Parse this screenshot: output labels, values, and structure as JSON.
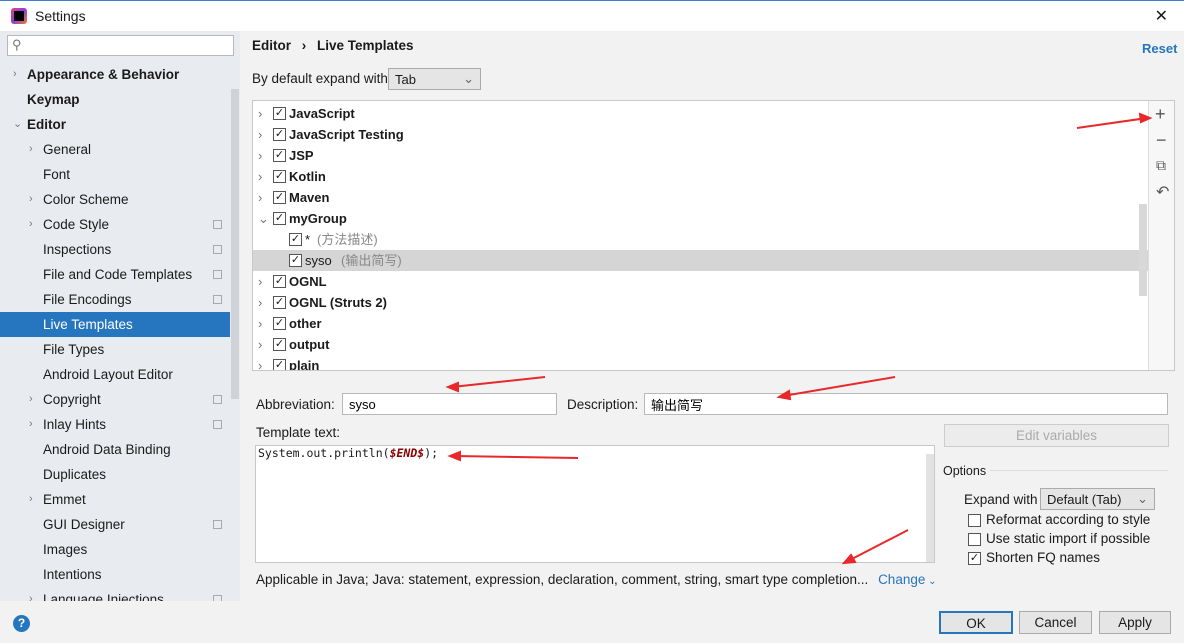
{
  "window": {
    "title": "Settings",
    "close": "✕"
  },
  "sidebar": {
    "search_placeholder": "",
    "items": [
      {
        "label": "Appearance & Behavior",
        "level": 0,
        "bold": true,
        "arrow": "›"
      },
      {
        "label": "Keymap",
        "level": 0,
        "bold": true,
        "arrow": ""
      },
      {
        "label": "Editor",
        "level": 0,
        "bold": true,
        "arrow": "⌄"
      },
      {
        "label": "General",
        "level": 1,
        "arrow": "›"
      },
      {
        "label": "Font",
        "level": 1,
        "arrow": ""
      },
      {
        "label": "Color Scheme",
        "level": 1,
        "arrow": "›"
      },
      {
        "label": "Code Style",
        "level": 1,
        "arrow": "›",
        "copy": true
      },
      {
        "label": "Inspections",
        "level": 1,
        "arrow": "",
        "copy": true
      },
      {
        "label": "File and Code Templates",
        "level": 1,
        "arrow": "",
        "copy": true
      },
      {
        "label": "File Encodings",
        "level": 1,
        "arrow": "",
        "copy": true
      },
      {
        "label": "Live Templates",
        "level": 1,
        "arrow": "",
        "selected": true
      },
      {
        "label": "File Types",
        "level": 1,
        "arrow": ""
      },
      {
        "label": "Android Layout Editor",
        "level": 1,
        "arrow": ""
      },
      {
        "label": "Copyright",
        "level": 1,
        "arrow": "›",
        "copy": true
      },
      {
        "label": "Inlay Hints",
        "level": 1,
        "arrow": "›",
        "copy": true
      },
      {
        "label": "Android Data Binding",
        "level": 1,
        "arrow": ""
      },
      {
        "label": "Duplicates",
        "level": 1,
        "arrow": ""
      },
      {
        "label": "Emmet",
        "level": 1,
        "arrow": "›"
      },
      {
        "label": "GUI Designer",
        "level": 1,
        "arrow": "",
        "copy": true
      },
      {
        "label": "Images",
        "level": 1,
        "arrow": ""
      },
      {
        "label": "Intentions",
        "level": 1,
        "arrow": ""
      },
      {
        "label": "Language Injections",
        "level": 1,
        "arrow": "›",
        "copy": true
      }
    ]
  },
  "breadcrumb": {
    "parent": "Editor",
    "sep": "›",
    "current": "Live Templates"
  },
  "reset": "Reset",
  "expand_default": {
    "label": "By default expand with",
    "value": "Tab"
  },
  "tree": [
    {
      "label": "JavaScript",
      "arrow": "›",
      "checked": true
    },
    {
      "label": "JavaScript Testing",
      "arrow": "›",
      "checked": true
    },
    {
      "label": "JSP",
      "arrow": "›",
      "checked": true
    },
    {
      "label": "Kotlin",
      "arrow": "›",
      "checked": true
    },
    {
      "label": "Maven",
      "arrow": "›",
      "checked": true
    },
    {
      "label": "myGroup",
      "arrow": "⌄",
      "checked": true
    },
    {
      "label": "*",
      "desc": "(方法描述)",
      "child": true,
      "checked": true
    },
    {
      "label": "syso",
      "desc": "(输出简写)",
      "child": true,
      "checked": true,
      "selected": true
    },
    {
      "label": "OGNL",
      "arrow": "›",
      "checked": true
    },
    {
      "label": "OGNL (Struts 2)",
      "arrow": "›",
      "checked": true
    },
    {
      "label": "other",
      "arrow": "›",
      "checked": true
    },
    {
      "label": "output",
      "arrow": "›",
      "checked": true
    },
    {
      "label": "plain",
      "arrow": "›",
      "checked": true
    }
  ],
  "toolbar": {
    "add": "+",
    "remove": "−",
    "copy": "⧉",
    "undo": "↶"
  },
  "abbreviation": {
    "label": "Abbreviation:",
    "value": "syso"
  },
  "description": {
    "label": "Description:",
    "value": "输出简写"
  },
  "template_text": {
    "label": "Template text:",
    "code_prefix": "System.out.println(",
    "variable": "$END$",
    "code_suffix": ");"
  },
  "edit_variables": "Edit variables",
  "options": {
    "title": "Options",
    "expand_label": "Expand with",
    "expand_value": "Default (Tab)",
    "checks": [
      {
        "label": "Reformat according to style",
        "checked": false
      },
      {
        "label": "Use static import if possible",
        "checked": false
      },
      {
        "label": "Shorten FQ names",
        "checked": true
      }
    ]
  },
  "applicable": {
    "text": "Applicable in Java; Java: statement, expression, declaration, comment, string, smart type completion...",
    "change": "Change"
  },
  "buttons": {
    "ok": "OK",
    "cancel": "Cancel",
    "apply": "Apply"
  },
  "colors": {
    "accent": "#2675bf",
    "variable": "#8b0000",
    "arrow": "#e8282b"
  }
}
